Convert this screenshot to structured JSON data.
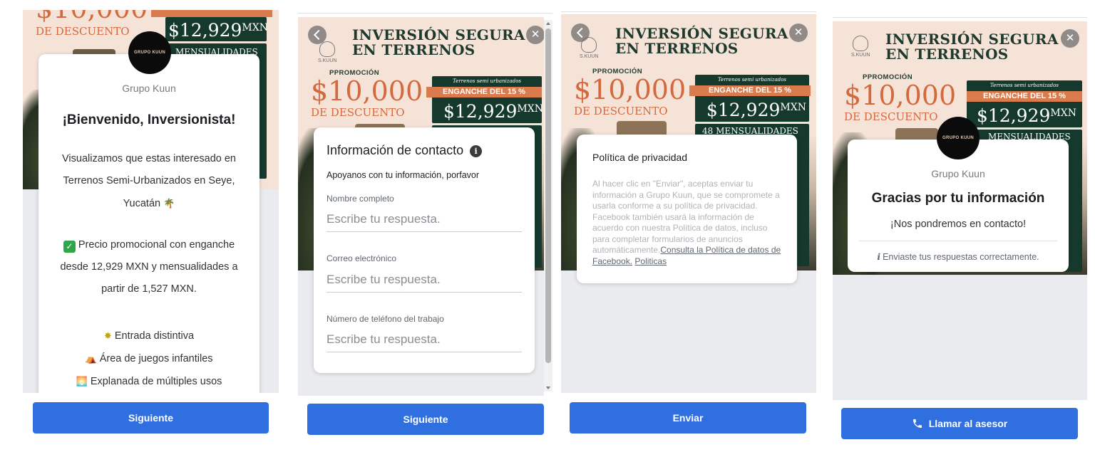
{
  "brand": {
    "name": "Grupo Kuun",
    "logo_text": "GRUPO KUUN",
    "banner_logo_text": "S.KUUN"
  },
  "colors": {
    "button_blue": "#2f6fdf",
    "banner_green": "#15392c",
    "banner_orange": "#d4693f",
    "banner_bg": "#f6e3d8"
  },
  "banner": {
    "title_line1": "INVERSIÓN SEGURA",
    "title_line2": "EN TERRENOS",
    "promo_small": "PPROMOCIÓN",
    "promo_amount": "$10,000",
    "promo_amount_cropped": "$10,000",
    "promo_desc": "DE DESCUENTO",
    "green_top": "Terrenos semi urbanizados",
    "ribbon": "ENGANCHE DEL 15 %",
    "price": "$12,929",
    "price_unit": "MXN",
    "mensual": "48 MENSUALIDADES",
    "mensual_cropped": "MENSUALIDADES"
  },
  "screen1": {
    "company": "Grupo Kuun",
    "heading": "¡Bienvenido, Inversionista!",
    "intro": "Visualizamos que estas interesado en Terrenos Semi-Urbanizados en Seye, Yucatán",
    "intro_emoji": "🌴",
    "promo_text": "Precio promocional con enganche desde 12,929 MXN y mensualidades a partir de 1,527 MXN.",
    "amenities": [
      {
        "icon": "star-burst-icon",
        "glyph": "✸",
        "label": "Entrada distintiva"
      },
      {
        "icon": "tent-icon",
        "glyph": "⛺",
        "label": "Área de juegos infantiles"
      },
      {
        "icon": "sunset-icon",
        "glyph": "🌅",
        "label": "Explanada de múltiples usos"
      }
    ],
    "button": "Siguiente"
  },
  "screen2": {
    "title": "Información de contacto",
    "subtitle": "Apoyanos con tu información, porfavor",
    "fields": [
      {
        "label": "Nombre completo",
        "placeholder": "Escribe tu respuesta."
      },
      {
        "label": "Correo electrónico",
        "placeholder": "Escribe tu respuesta."
      },
      {
        "label": "Número de teléfono del trabajo",
        "placeholder": "Escribe tu respuesta."
      }
    ],
    "button": "Siguiente"
  },
  "screen3": {
    "title": "Política de privacidad",
    "body": "Al hacer clic en \"Enviar\", aceptas enviar tu información a Grupo Kuun, que se compromete a usarla conforme a su política de privacidad. Facebook también usará la información de acuerdo con nuestra Política de datos, incluso para completar formularios de anuncios automáticamente.",
    "link1": "Consulta la Política de datos de Facebook.",
    "link2": "Politicas",
    "button": "Enviar"
  },
  "screen4": {
    "company": "Grupo Kuun",
    "heading": "Gracias por tu información",
    "message": "¡Nos pondremos en contacto!",
    "note": "Enviaste tus respuestas correctamente.",
    "button": "Llamar al asesor"
  }
}
